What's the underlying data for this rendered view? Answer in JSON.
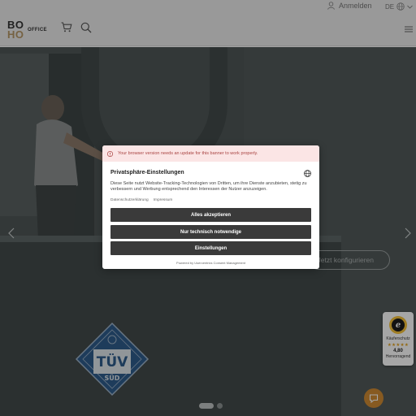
{
  "topbar": {
    "login_label": "Anmelden",
    "language": "DE"
  },
  "header": {
    "logo_top": "BO",
    "logo_bottom": "HO",
    "logo_suffix": "OFFICE"
  },
  "hero": {
    "cta_label": "Jetzt konfigurieren",
    "slides_total": 2,
    "slide_active": 1
  },
  "trust_badge": {
    "label": "Käuferschutz",
    "stars": "★★★★★",
    "score": "4,80",
    "rating_text": "Hervorragend"
  },
  "consent": {
    "warning": "Your browser version needs an update for this banner to work properly.",
    "title": "Privatsphäre-Einstellungen",
    "description": "Diese Seite nutzt Website-Tracking-Technologien von Dritten, um ihre Dienste anzubieten, stetig zu verbessern und Werbung entsprechend den Interessen der Nutzer anzuzeigen.",
    "link_privacy": "Datenschutzerklärung",
    "link_imprint": "Impressum",
    "accept_all": "Alles akzeptieren",
    "necessary_only": "Nur technisch notwendige",
    "settings": "Einstellungen",
    "powered_by": "Powered by Usercentrics Consent Management"
  },
  "colors": {
    "brand_gold": "#b59766",
    "button_dark": "#3a3a3a",
    "chat_orange": "#d08a33",
    "warning_bg": "#fbe5e5"
  }
}
